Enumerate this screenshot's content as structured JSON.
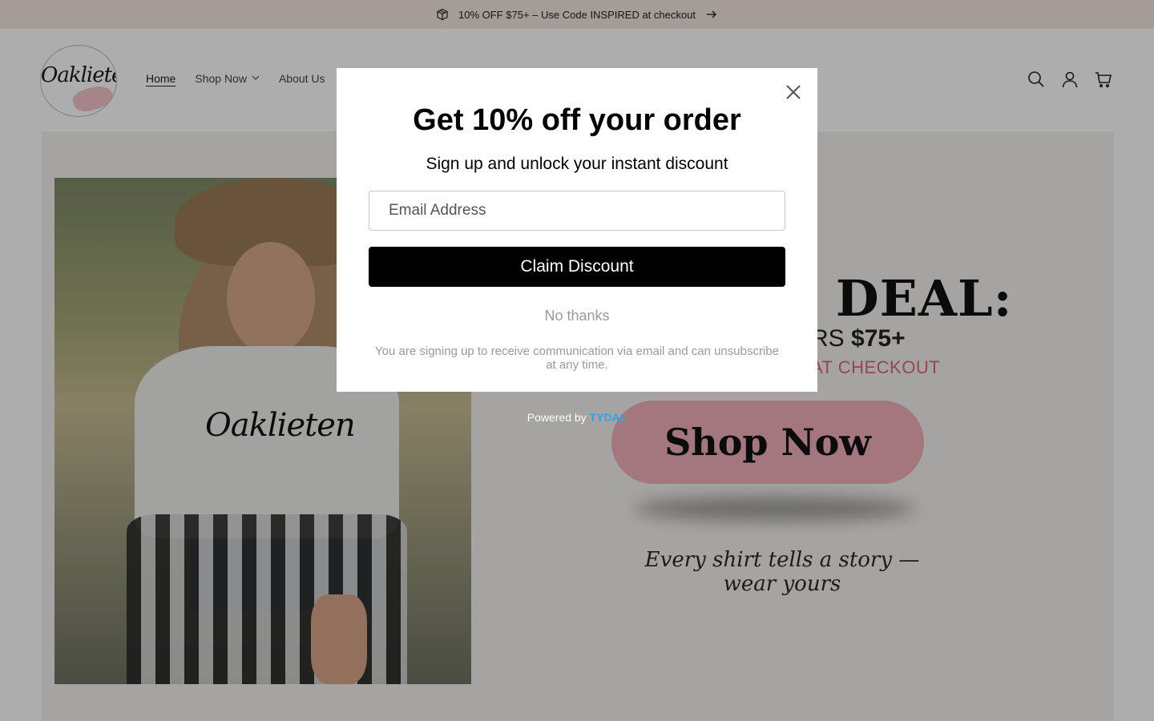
{
  "announcement": {
    "icon": "package-icon",
    "text": "10% OFF $75+ – Use Code INSPIRED at checkout",
    "arrow_icon": "arrow-right-icon"
  },
  "header": {
    "logo_text": "Oaklieten",
    "nav": [
      {
        "label": "Home",
        "active": true
      },
      {
        "label": "Shop Now",
        "has_dropdown": true
      },
      {
        "label": "About Us"
      }
    ],
    "icons": [
      "search-icon",
      "account-icon",
      "cart-icon"
    ]
  },
  "hero": {
    "shirt_text": "Oaklieten",
    "deal_title": "E DEAL:",
    "deal_sub_prefix": "ERS ",
    "deal_sub_amount": "$75+",
    "deal_code": "AT CHECKOUT",
    "cta_label": "Shop Now",
    "tagline": "Every shirt tells a story — wear yours"
  },
  "modal": {
    "title": "Get 10% off your order",
    "subtitle": "Sign up and unlock your instant discount",
    "email_placeholder": "Email Address",
    "claim_label": "Claim Discount",
    "no_thanks": "No thanks",
    "disclaimer": "You are signing up to receive communication via email and can unsubscribe at any time.",
    "close_icon": "close-icon"
  },
  "powered": {
    "prefix": "Powered by ",
    "brand": "TYDAL",
    "brand_color": "#3aa0e6"
  },
  "colors": {
    "announcement_bg": "#f3e5df",
    "cta_pink": "#f2aeb8",
    "claim_button": "#000000"
  }
}
